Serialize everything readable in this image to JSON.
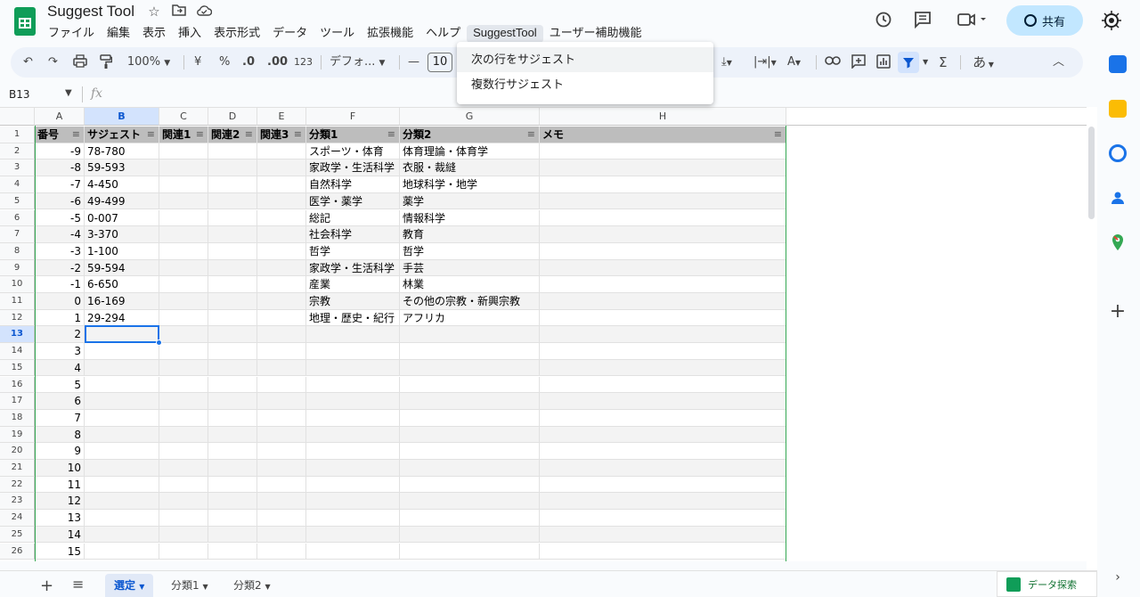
{
  "app": {
    "title": "Suggest Tool",
    "star_icon": "star-icon",
    "folder_icon": "move-folder-icon",
    "cloud_icon": "cloud-status-icon"
  },
  "menu": {
    "items": [
      "ファイル",
      "編集",
      "表示",
      "挿入",
      "表示形式",
      "データ",
      "ツール",
      "拡張機能",
      "ヘルプ",
      "SuggestTool",
      "ユーザー補助機能"
    ],
    "active_index": 9
  },
  "header": {
    "share_label": "共有",
    "history_icon": "history-icon",
    "comment_icon": "comment-icon",
    "meet_icon": "video-call-icon"
  },
  "toolbar": {
    "zoom": "100%",
    "currency": "¥",
    "percent": "%",
    "decrease_decimal": ".0",
    "increase_decimal": ".00",
    "more_formats": "123",
    "font": "デフォ...",
    "font_size": "10",
    "input_tool": "あ",
    "sigma": "Σ"
  },
  "formula_bar": {
    "cell_ref": "B13",
    "fx": "fx"
  },
  "dropdown": {
    "items": [
      "次の行をサジェスト",
      "複数行サジェスト"
    ]
  },
  "grid": {
    "columns": [
      "A",
      "B",
      "C",
      "D",
      "E",
      "F",
      "G",
      "H"
    ],
    "header_row": [
      "番号",
      "サジェスト",
      "関連1",
      "関連2",
      "関連3",
      "分類1",
      "分類2",
      "メモ"
    ],
    "row_numbers": [
      "1",
      "2",
      "3",
      "4",
      "5",
      "6",
      "7",
      "8",
      "9",
      "10",
      "11",
      "12",
      "13",
      "14",
      "15",
      "16",
      "17",
      "18",
      "19",
      "20",
      "21",
      "22",
      "23",
      "24",
      "25",
      "26"
    ],
    "rows": [
      [
        "-9",
        "78-780",
        "",
        "",
        "",
        "スポーツ・体育",
        "体育理論・体育学",
        ""
      ],
      [
        "-8",
        "59-593",
        "",
        "",
        "",
        "家政学・生活科学",
        "衣服・裁縫",
        ""
      ],
      [
        "-7",
        "4-450",
        "",
        "",
        "",
        "自然科学",
        "地球科学・地学",
        ""
      ],
      [
        "-6",
        "49-499",
        "",
        "",
        "",
        "医学・薬学",
        "薬学",
        ""
      ],
      [
        "-5",
        "0-007",
        "",
        "",
        "",
        "総記",
        "情報科学",
        ""
      ],
      [
        "-4",
        "3-370",
        "",
        "",
        "",
        "社会科学",
        "教育",
        ""
      ],
      [
        "-3",
        "1-100",
        "",
        "",
        "",
        "哲学",
        "哲学",
        ""
      ],
      [
        "-2",
        "59-594",
        "",
        "",
        "",
        "家政学・生活科学",
        "手芸",
        ""
      ],
      [
        "-1",
        "6-650",
        "",
        "",
        "",
        "産業",
        "林業",
        ""
      ],
      [
        "0",
        "16-169",
        "",
        "",
        "",
        "宗教",
        "その他の宗教・新興宗教",
        ""
      ],
      [
        "1",
        "29-294",
        "",
        "",
        "",
        "地理・歴史・紀行",
        "アフリカ",
        ""
      ],
      [
        "2",
        "",
        "",
        "",
        "",
        "",
        "",
        ""
      ],
      [
        "3",
        "",
        "",
        "",
        "",
        "",
        "",
        ""
      ],
      [
        "4",
        "",
        "",
        "",
        "",
        "",
        "",
        ""
      ],
      [
        "5",
        "",
        "",
        "",
        "",
        "",
        "",
        ""
      ],
      [
        "6",
        "",
        "",
        "",
        "",
        "",
        "",
        ""
      ],
      [
        "7",
        "",
        "",
        "",
        "",
        "",
        "",
        ""
      ],
      [
        "8",
        "",
        "",
        "",
        "",
        "",
        "",
        ""
      ],
      [
        "9",
        "",
        "",
        "",
        "",
        "",
        "",
        ""
      ],
      [
        "10",
        "",
        "",
        "",
        "",
        "",
        "",
        ""
      ],
      [
        "11",
        "",
        "",
        "",
        "",
        "",
        "",
        ""
      ],
      [
        "12",
        "",
        "",
        "",
        "",
        "",
        "",
        ""
      ],
      [
        "13",
        "",
        "",
        "",
        "",
        "",
        "",
        ""
      ],
      [
        "14",
        "",
        "",
        "",
        "",
        "",
        "",
        ""
      ],
      [
        "15",
        "",
        "",
        "",
        "",
        "",
        "",
        ""
      ]
    ],
    "selected_cell": "B13",
    "selected_row": "13",
    "selected_col": "B"
  },
  "sheets": {
    "tabs": [
      "選定",
      "分類1",
      "分類2"
    ],
    "active_index": 0,
    "add_icon": "add-sheet-icon",
    "list_icon": "all-sheets-icon"
  },
  "explore": {
    "label": "データ探索"
  },
  "side_panel": {
    "icons": [
      "calendar-icon",
      "keep-icon",
      "tasks-icon",
      "contacts-icon",
      "maps-icon",
      "add-addon-icon"
    ]
  },
  "colors": {
    "accent": "#0b57d0",
    "share_bg": "#c2e7ff",
    "header_row_bg": "#bdbdbd",
    "selection": "#1a73e8",
    "sheets_green": "#0f9d58"
  }
}
